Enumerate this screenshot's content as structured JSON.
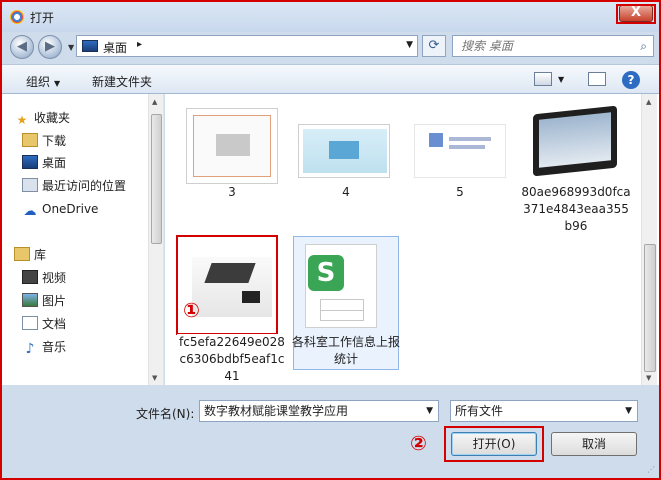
{
  "window": {
    "title": "打开",
    "close": "X"
  },
  "nav": {
    "back": "◀",
    "forward": "▶",
    "address": "桌面",
    "address_chevron": "▸",
    "refresh": "⟳",
    "search_placeholder": "搜索 桌面"
  },
  "toolbar": {
    "organize": "组织",
    "new_folder": "新建文件夹",
    "help": "?"
  },
  "sidebar": {
    "favorites_title": "收藏夹",
    "favorites": [
      {
        "label": "下载",
        "icon": "download-folder-icon"
      },
      {
        "label": "桌面",
        "icon": "desktop-icon"
      },
      {
        "label": "最近访问的位置",
        "icon": "recent-places-icon"
      },
      {
        "label": "OneDrive",
        "icon": "onedrive-icon"
      }
    ],
    "library_title": "库",
    "libraries": [
      {
        "label": "视频",
        "icon": "video-library-icon"
      },
      {
        "label": "图片",
        "icon": "pictures-library-icon"
      },
      {
        "label": "文档",
        "icon": "documents-library-icon"
      },
      {
        "label": "音乐",
        "icon": "music-library-icon"
      }
    ]
  },
  "files": [
    {
      "name": "3"
    },
    {
      "name": "4"
    },
    {
      "name": "5"
    },
    {
      "name": "80ae968993d0fca371e4843eaa355b96"
    },
    {
      "name": "fc5efa22649e028c6306bdbf5eaf1c41"
    },
    {
      "name": "各科室工作信息上报统计"
    }
  ],
  "annotations": {
    "one": "①",
    "two": "②"
  },
  "bottom": {
    "filename_label": "文件名(N):",
    "filename_value": "数字教材赋能课堂教学应用",
    "filter_value": "所有文件",
    "open_label": "打开(O)",
    "cancel_label": "取消"
  },
  "colors": {
    "annotation_red": "#d40000",
    "frame_blue": "#cfdcec",
    "wps_green": "#3aa655"
  }
}
